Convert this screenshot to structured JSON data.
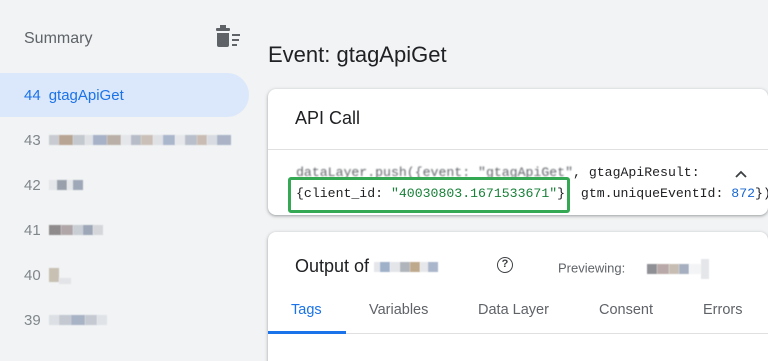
{
  "sidebar": {
    "title": "Summary",
    "active_item": {
      "number": "44",
      "name": "gtagApiGet"
    },
    "items": [
      {
        "number": "43"
      },
      {
        "number": "42"
      },
      {
        "number": "41"
      },
      {
        "number": "40"
      },
      {
        "number": "39"
      }
    ]
  },
  "main": {
    "title": "Event: gtagApiGet",
    "api_card": {
      "title": "API Call",
      "code_line1_prefix": "dataLayer.push({event: ",
      "code_line1_event": "\"gtagApiGet\"",
      "code_line1_suffix": ", gtagApiResult:",
      "code_line2_prefix": "{client_id: ",
      "code_line2_value": "\"40030803.1671533671\"",
      "code_line2_mid": "}, gtm.uniqueEventId: ",
      "code_line2_num": "872",
      "code_line2_end": "})"
    },
    "output_card": {
      "title": "Output of ",
      "help_glyph": "?",
      "previewing_label": "Previewing:",
      "tabs": [
        {
          "label": "Tags"
        },
        {
          "label": "Variables"
        },
        {
          "label": "Data Layer"
        },
        {
          "label": "Consent"
        },
        {
          "label": "Errors"
        }
      ],
      "active_tab": "Tags"
    }
  },
  "colors": {
    "accent": "#1a73e8",
    "highlight_border": "#34a853",
    "active_bg": "#dbe7fb"
  },
  "icons": [
    "delete-sweep-icon",
    "chevron-up-icon",
    "help-icon"
  ]
}
